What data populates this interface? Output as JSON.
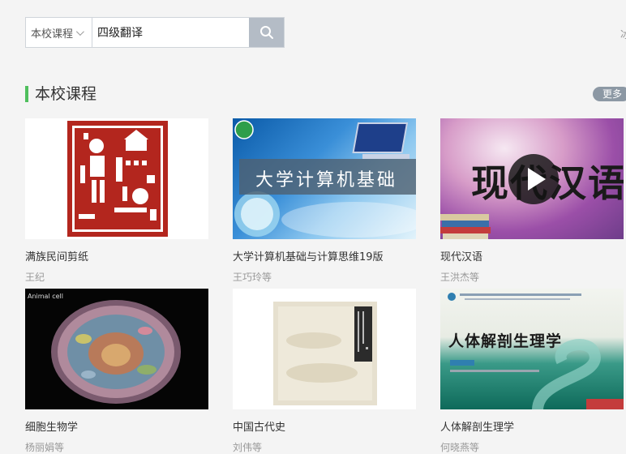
{
  "search": {
    "scope": "本校课程",
    "query": "四级翻译"
  },
  "header": {
    "edge_text": "冰"
  },
  "section": {
    "title": "本校课程",
    "more": "更多"
  },
  "courses": [
    {
      "title": "满族民间剪纸",
      "author": "王纪"
    },
    {
      "title": "大学计算机基础与计算思维19版",
      "author": "王巧玲等",
      "cover_text": "大学计算机基础"
    },
    {
      "title": "现代汉语",
      "author": "王洪杰等",
      "cover_text": "现代汉语"
    },
    {
      "title": "细胞生物学",
      "author": "杨丽娟等",
      "cover_text": "Animal cell"
    },
    {
      "title": "中国古代史",
      "author": "刘伟等"
    },
    {
      "title": "人体解剖生理学",
      "author": "何晓燕等",
      "cover_text": "人体解剖生理学"
    }
  ],
  "colors": {
    "accent": "#4fbf5d",
    "search_button": "#b4bcc6",
    "more_button": "#8c98a4",
    "papercut_red": "#b3261e"
  }
}
